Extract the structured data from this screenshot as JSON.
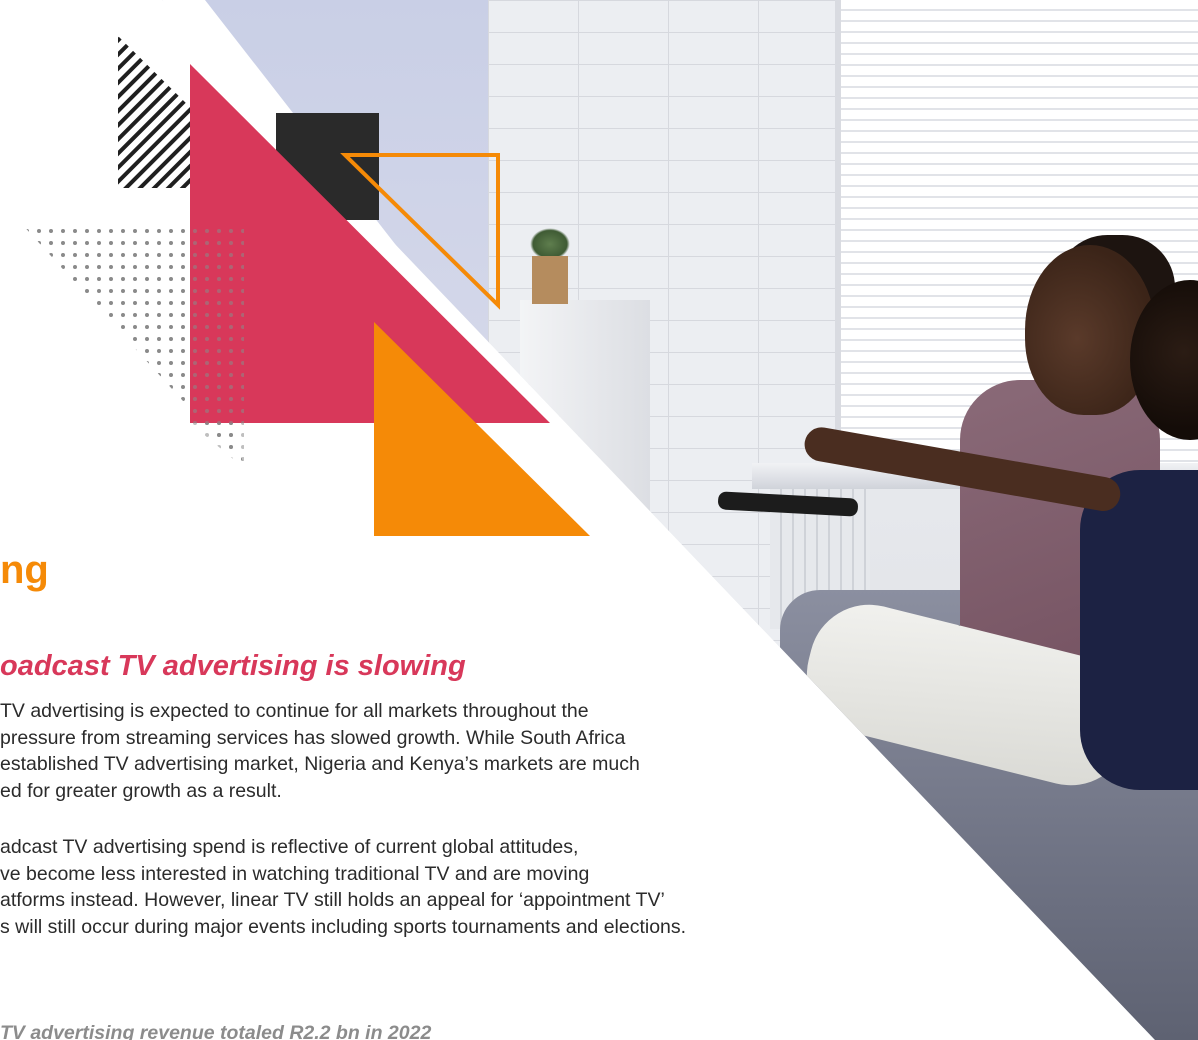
{
  "section": {
    "title": "ng"
  },
  "subheading": "oadcast TV advertising is slowing",
  "paragraphs": [
    {
      "lines": [
        "TV advertising is expected to continue for all markets throughout the",
        "pressure from streaming services has slowed growth. While South Africa",
        "established TV advertising market, Nigeria and Kenya’s markets are much",
        "ed for greater growth as a result."
      ]
    },
    {
      "lines": [
        "adcast TV advertising spend is reflective of current global attitudes,",
        "ve become less interested in watching traditional TV and are moving",
        "atforms instead. However, linear TV still holds an appeal for ‘appointment TV’",
        "s will still occur during major events including sports tournaments and elections."
      ]
    }
  ],
  "footnote": "TV advertising revenue totaled R2.2 bn in 2022",
  "colors": {
    "orange": "#f58a07",
    "crimson": "#d8385a",
    "dark": "#2b2b2b",
    "muted": "#8c8c8c"
  },
  "photo": {
    "icon": "couple-watching-tv-photo"
  }
}
